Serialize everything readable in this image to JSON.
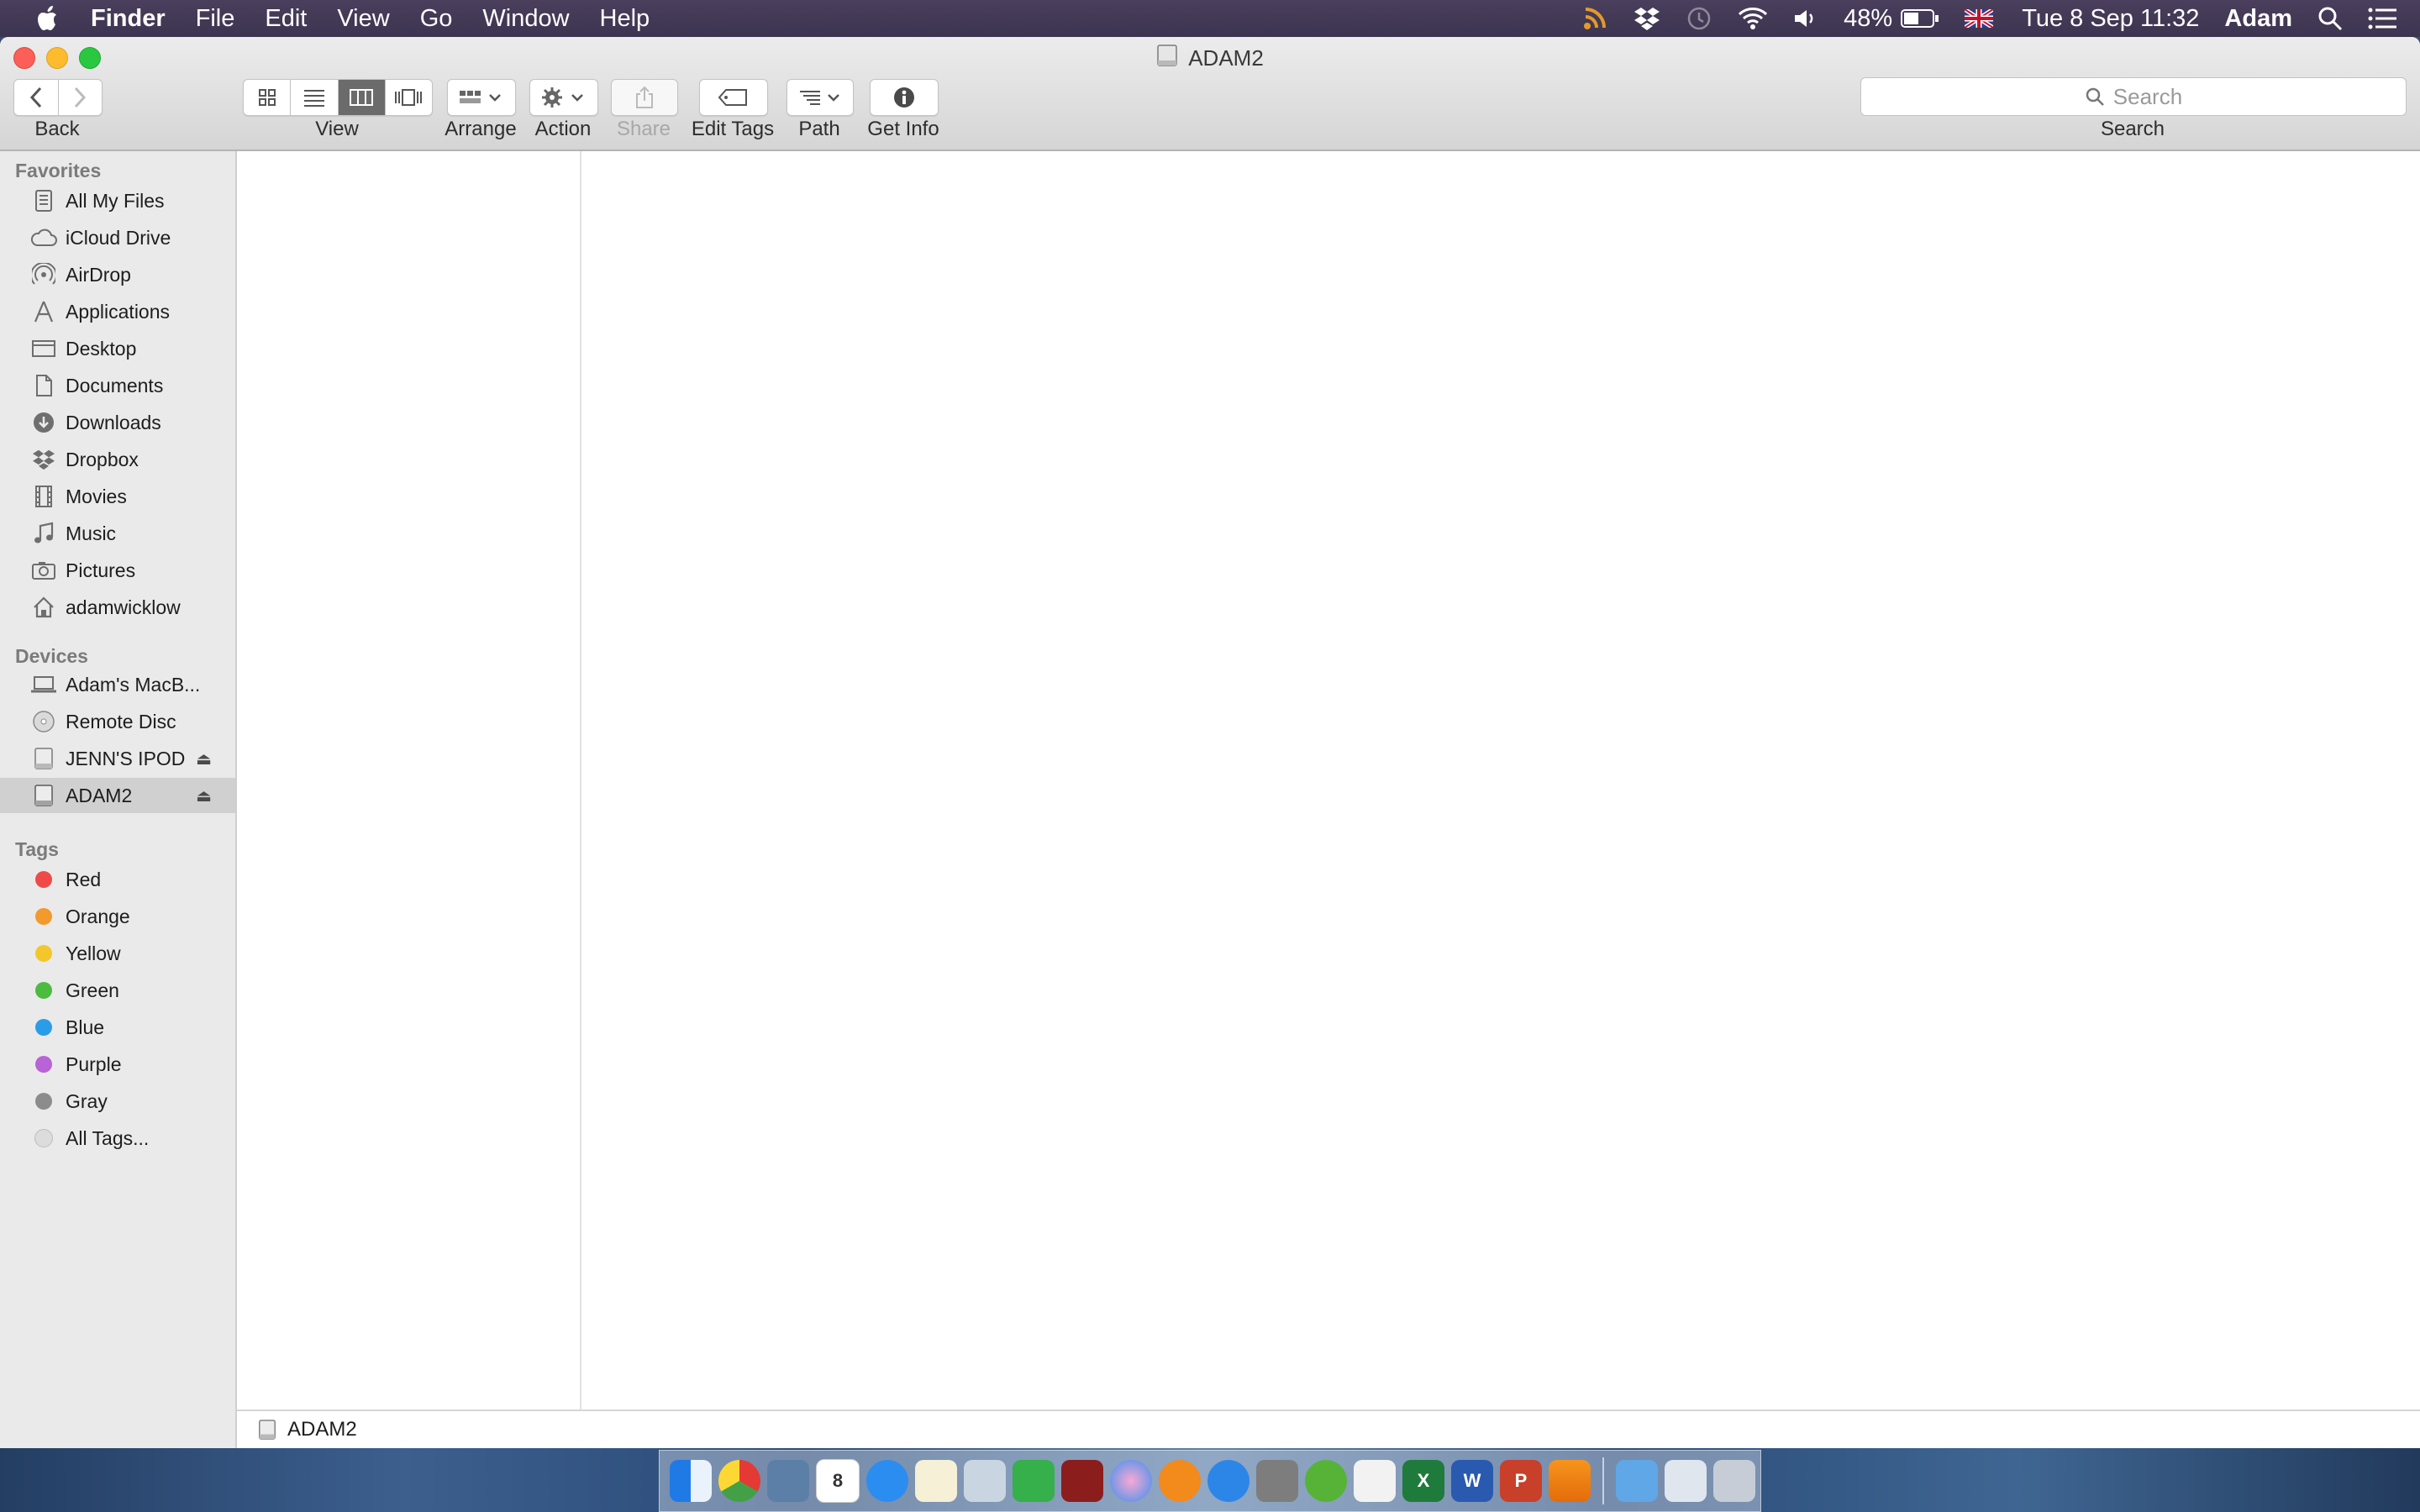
{
  "menubar": {
    "app_name": "Finder",
    "menus": [
      "File",
      "Edit",
      "View",
      "Go",
      "Window",
      "Help"
    ],
    "battery": "48%",
    "clock": "Tue 8 Sep  11:32",
    "user": "Adam",
    "status_icons": [
      "rss-icon",
      "dropbox-icon",
      "time-machine-icon",
      "wifi-icon",
      "volume-icon",
      "battery-icon",
      "uk-flag-icon",
      "spotlight-icon",
      "notification-center-icon"
    ]
  },
  "window": {
    "title": "ADAM2"
  },
  "toolbar": {
    "back_label": "Back",
    "view_label": "View",
    "arrange_label": "Arrange",
    "action_label": "Action",
    "share_label": "Share",
    "edit_tags_label": "Edit Tags",
    "path_label": "Path",
    "get_info_label": "Get Info",
    "search_placeholder": "Search",
    "search_label": "Search",
    "active_view": "column"
  },
  "sidebar": {
    "favorites_heading": "Favorites",
    "favorites": [
      {
        "label": "All My Files",
        "icon": "all-files-icon"
      },
      {
        "label": "iCloud Drive",
        "icon": "cloud-icon"
      },
      {
        "label": "AirDrop",
        "icon": "airdrop-icon"
      },
      {
        "label": "Applications",
        "icon": "applications-icon"
      },
      {
        "label": "Desktop",
        "icon": "desktop-icon"
      },
      {
        "label": "Documents",
        "icon": "documents-icon"
      },
      {
        "label": "Downloads",
        "icon": "downloads-icon"
      },
      {
        "label": "Dropbox",
        "icon": "dropbox-icon"
      },
      {
        "label": "Movies",
        "icon": "movies-icon"
      },
      {
        "label": "Music",
        "icon": "music-icon"
      },
      {
        "label": "Pictures",
        "icon": "pictures-icon"
      },
      {
        "label": "adamwicklow",
        "icon": "home-icon"
      }
    ],
    "devices_heading": "Devices",
    "devices": [
      {
        "label": "Adam's MacB...",
        "icon": "laptop-icon"
      },
      {
        "label": "Remote Disc",
        "icon": "disc-icon"
      },
      {
        "label": "JENN'S IPOD",
        "icon": "drive-icon"
      },
      {
        "label": "ADAM2",
        "icon": "drive-icon"
      }
    ],
    "tags_heading": "Tags",
    "tags": [
      {
        "label": "Red",
        "color": "#f04a48"
      },
      {
        "label": "Orange",
        "color": "#f39a2d"
      },
      {
        "label": "Yellow",
        "color": "#f3c72c"
      },
      {
        "label": "Green",
        "color": "#4cbb3f"
      },
      {
        "label": "Blue",
        "color": "#2b9de8"
      },
      {
        "label": "Purple",
        "color": "#b863d6"
      },
      {
        "label": "Gray",
        "color": "#8c8c8c"
      },
      {
        "label": "All Tags...",
        "color": "#dcdcdc"
      }
    ]
  },
  "pathbar": {
    "item": "ADAM2"
  },
  "dock": {
    "apps": [
      "finder-icon",
      "chrome-icon",
      "preview-icon",
      "calendar-icon",
      "messages-icon",
      "notes-icon",
      "photos-icon",
      "facetime-icon",
      "photo-booth-icon",
      "itunes-icon",
      "ibooks-icon",
      "app-store-icon",
      "system-preferences-icon",
      "utorrent-icon",
      "textedit-icon",
      "excel-icon",
      "word-icon",
      "powerpoint-icon",
      "vlc-icon"
    ],
    "calendar_day": "8",
    "others": [
      "downloads-stack-icon",
      "documents-stack-icon",
      "trash-icon"
    ]
  }
}
